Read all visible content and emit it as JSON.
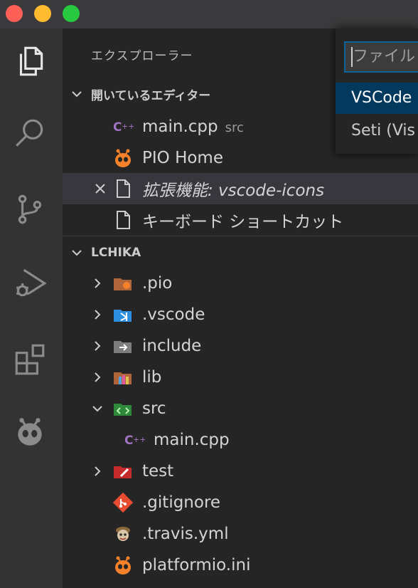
{
  "window": {
    "traffic_lights": [
      "#fe5f57",
      "#febc2e",
      "#28c840"
    ]
  },
  "activity_bar": {
    "items": [
      "explorer-icon",
      "search-icon",
      "source-control-icon",
      "run-debug-icon",
      "extensions-icon",
      "platformio-icon"
    ]
  },
  "sidebar": {
    "title": "エクスプローラー",
    "open_editors": {
      "header": "開いているエディター",
      "items": [
        {
          "label": "main.cpp",
          "description": "src",
          "icon": "cpp-icon"
        },
        {
          "label": "PIO Home",
          "icon": "platformio-icon"
        },
        {
          "label": "拡張機能: vscode-icons",
          "icon": "file-icon",
          "selected": true
        },
        {
          "label": "キーボード ショートカット",
          "icon": "file-icon"
        }
      ]
    },
    "project": {
      "header": "LCHIKA",
      "items": [
        {
          "label": ".pio",
          "icon": "pio-folder-icon"
        },
        {
          "label": ".vscode",
          "icon": "vscode-folder-icon"
        },
        {
          "label": "include",
          "icon": "include-folder-icon"
        },
        {
          "label": "lib",
          "icon": "lib-folder-icon"
        },
        {
          "label": "src",
          "icon": "src-folder-icon"
        },
        {
          "label": "main.cpp",
          "icon": "cpp-icon"
        },
        {
          "label": "test",
          "icon": "test-folder-icon"
        },
        {
          "label": ".gitignore",
          "icon": "git-icon"
        },
        {
          "label": ".travis.yml",
          "icon": "travis-icon"
        },
        {
          "label": "platformio.ini",
          "icon": "platformio-icon"
        }
      ]
    }
  },
  "quick_pick": {
    "input_placeholder": "ファイル",
    "options": [
      {
        "label": "VSCode",
        "active": true
      },
      {
        "label": "Seti (Vis"
      }
    ]
  },
  "colors": {
    "accent": "#0e639c",
    "cpp": "#a074c4",
    "platformio": "#f5822a",
    "vscode": "#2d8ee0",
    "src": "#3aa04a",
    "test": "#c62b2b",
    "git": "#e84d31"
  }
}
